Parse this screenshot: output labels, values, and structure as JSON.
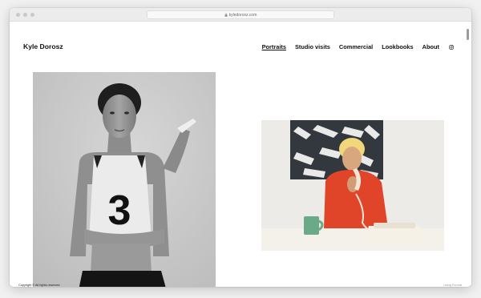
{
  "browser": {
    "url": "kyledorosz.com"
  },
  "site": {
    "title": "Kyle Dorosz"
  },
  "nav": {
    "items": [
      "Portraits",
      "Studio visits",
      "Commercial",
      "Lookbooks",
      "About"
    ],
    "active": "Portraits",
    "social_icon": "instagram-icon"
  },
  "gallery": [
    {
      "name": "bw-portrait-photo",
      "jersey_number": "3"
    },
    {
      "name": "color-portrait-photo"
    }
  ],
  "footer": {
    "copyright": "Copyright © All rights reserved.",
    "credit": "Using Format"
  },
  "colors": {
    "text": "#111111",
    "background": "#ffffff",
    "muted": "#9a9a9a"
  }
}
